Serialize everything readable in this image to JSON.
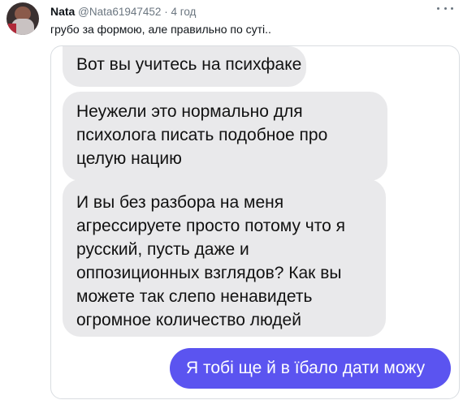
{
  "tweet": {
    "author_name": "Nata",
    "author_handle": "@Nata61947452",
    "separator": "·",
    "timestamp": "4 год",
    "text": "грубо за формою, але правильно по суті..",
    "more_icon": "more-horizontal-icon"
  },
  "chat": {
    "incoming": [
      {
        "lines": [
          "Вот вы учитесь на психфаке"
        ]
      },
      {
        "lines": [
          "Неужели это нормально для",
          "психолога писать подобное про",
          "целую нацию"
        ]
      },
      {
        "lines": [
          "И вы без разбора на меня",
          "агрессируете просто потому что я",
          "русский, пусть даже и",
          "оппозиционных взглядов? Как вы",
          "можете так слепо ненавидеть",
          "огромное количество людей"
        ]
      }
    ],
    "outgoing": {
      "text": "Я тобі ще й в їбало дати можу"
    },
    "colors": {
      "incoming_bubble": "#e9e9eb",
      "outgoing_bubble": "#5b54f0"
    }
  }
}
